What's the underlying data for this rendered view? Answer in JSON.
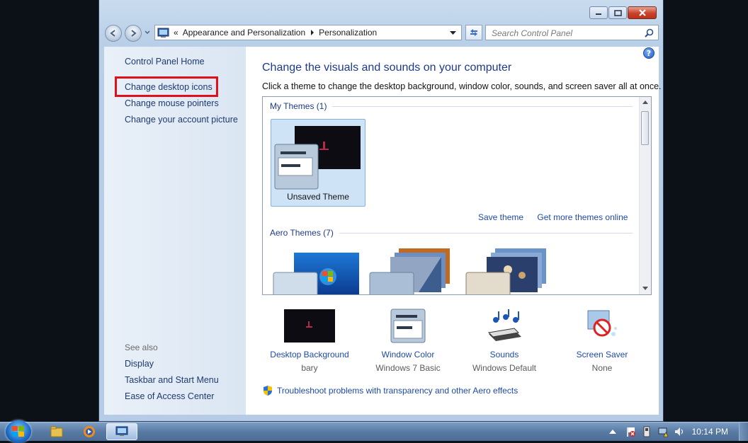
{
  "address": {
    "overflow": "«",
    "crumbs": [
      "Appearance and Personalization",
      "Personalization"
    ]
  },
  "search": {
    "placeholder": "Search Control Panel"
  },
  "sidebar": {
    "home": "Control Panel Home",
    "links": [
      "Change desktop icons",
      "Change mouse pointers",
      "Change your account picture"
    ],
    "see_also_label": "See also",
    "see_also": [
      "Display",
      "Taskbar and Start Menu",
      "Ease of Access Center"
    ]
  },
  "main": {
    "title": "Change the visuals and sounds on your computer",
    "subtitle": "Click a theme to change the desktop background, window color, sounds, and screen saver all at once.",
    "my_themes_label": "My Themes (1)",
    "unsaved_theme": "Unsaved Theme",
    "save_theme": "Save theme",
    "get_more": "Get more themes online",
    "aero_label": "Aero Themes (7)",
    "bottom": [
      {
        "title": "Desktop Background",
        "sub": "bary"
      },
      {
        "title": "Window Color",
        "sub": "Windows 7 Basic"
      },
      {
        "title": "Sounds",
        "sub": "Windows Default"
      },
      {
        "title": "Screen Saver",
        "sub": "None"
      }
    ],
    "troubleshoot": "Troubleshoot problems with transparency and other Aero effects"
  },
  "taskbar": {
    "clock": "10:14 PM"
  },
  "colors": {
    "accent": "#1e4aa6",
    "highlight": "#e0101a",
    "title_blue": "#1e3a8c"
  }
}
